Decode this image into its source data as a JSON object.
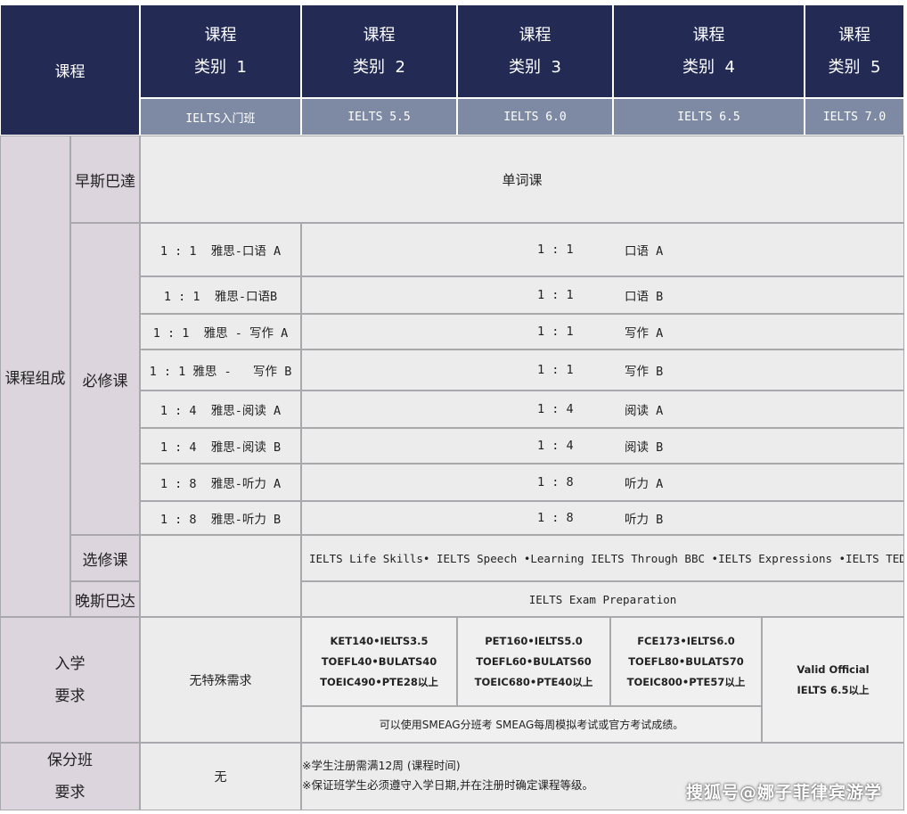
{
  "header": {
    "corner_label": "课程",
    "categories": [
      {
        "line1": "课程",
        "line2": "类别  1",
        "level": "IELTS入门班"
      },
      {
        "line1": "课程",
        "line2": "类别  2",
        "level": "IELTS 5.5"
      },
      {
        "line1": "课程",
        "line2": "类别  3",
        "level": "IELTS 6.0"
      },
      {
        "line1": "课程",
        "line2": "类别  4",
        "level": "IELTS 6.5"
      },
      {
        "line1": "课程",
        "line2": "类别  5",
        "level": "IELTS 7.0"
      }
    ]
  },
  "composition": {
    "label": "课程组成",
    "morning": {
      "label": "早斯巴達",
      "content": "单词课"
    },
    "required": {
      "label": "必修课",
      "rows": [
        {
          "left": "1 : 1  雅思-口语 A",
          "ratio": "1 : 1",
          "subject": "口语 A"
        },
        {
          "left": "1 : 1  雅思-口语B",
          "ratio": "1 : 1",
          "subject": "口语 B"
        },
        {
          "left": "1 : 1  雅思 - 写作 A",
          "ratio": "1 : 1",
          "subject": "写作 A"
        },
        {
          "left": "1 : 1 雅思 -   写作 B",
          "ratio": "1 : 1",
          "subject": "写作 B"
        },
        {
          "left": "1 : 4  雅思-阅读 A",
          "ratio": "1 : 4",
          "subject": "阅读 A"
        },
        {
          "left": "1 : 4  雅思-阅读 B",
          "ratio": "1 : 4",
          "subject": "阅读 B"
        },
        {
          "left": "1 : 8  雅思-听力 A",
          "ratio": "1 : 8",
          "subject": "听力 A"
        },
        {
          "left": "1 : 8  雅思-听力 B",
          "ratio": "1 : 8",
          "subject": "听力 B"
        }
      ]
    },
    "elective": {
      "label": "选修课",
      "content": "IELTS Life Skills• IELTS Speech •Learning IELTS Through BBC •IELTS Expressions •IELTS TED Talk"
    },
    "evening": {
      "label": "晚斯巴达",
      "content": "IELTS Exam Preparation"
    }
  },
  "admission": {
    "label_line1": "入学",
    "label_line2": "要求",
    "cat1": "无特殊需求",
    "cat2": [
      "KET140•IELTS3.5",
      "TOEFL40•BULATS40",
      "TOEIC490•PTE28以上"
    ],
    "cat3": [
      "PET160•IELTS5.0",
      "TOEFL60•BULATS60",
      "TOEIC680•PTE40以上"
    ],
    "cat4": [
      "FCE173•IELTS6.0",
      "TOEFL80•BULATS70",
      "TOEIC800•PTE57以上"
    ],
    "cat5": [
      "Valid Official",
      "IELTS 6.5以上"
    ],
    "footnote": "可以使用SMEAG分班考 SMEAG每周模拟考试或官方考试成绩。"
  },
  "guarantee": {
    "label_line1": "保分班",
    "label_line2": "要求",
    "cat1": "无",
    "notes": [
      "※学生注册需满12周 (课程时间)",
      "※保证班学生必须遵守入学日期,并在注册时确定课程等级。"
    ]
  },
  "watermark": "搜狐号@娜子菲律宾游学",
  "colors": {
    "header_navy": "#232b55",
    "level_steel": "#7e8aa3",
    "label_mauve": "#dcd5de",
    "body_gray": "#ececec"
  }
}
